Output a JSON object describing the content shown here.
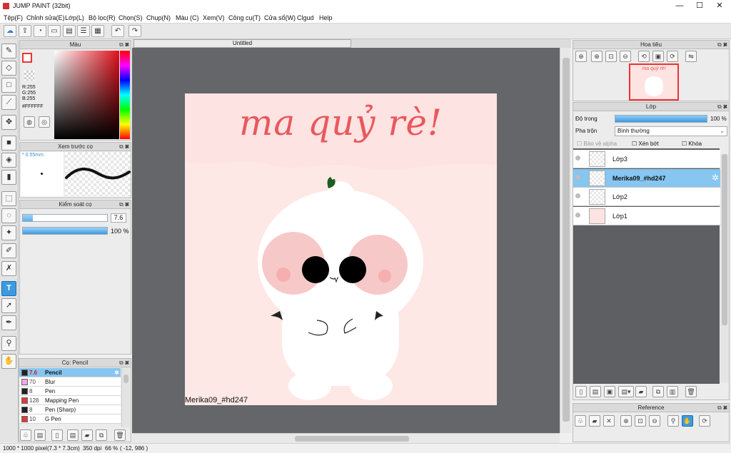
{
  "window": {
    "title": "JUMP PAINT (32bit)",
    "minimize": "—",
    "maximize": "☐",
    "close": "✕"
  },
  "menu": [
    "Tệp(F)",
    "Chỉnh sửa(E)",
    "Lớp(L)",
    "Bộ lọc(R)",
    "Chọn(S)",
    "Chụp(N)",
    "Màu (C)",
    "Xem(V)",
    "Công cụ(T)",
    "Cửa sổ(W)",
    "Clgud",
    "Help"
  ],
  "toolbar_icons": [
    "cloud-icon",
    "export-icon",
    "speech-icon",
    "screen-icon",
    "page-icon",
    "list-icon",
    "grid-icon",
    "undo-icon",
    "redo-icon"
  ],
  "color_panel": {
    "title": "Màu",
    "r": "R:255",
    "g": "G:255",
    "b": "B:255",
    "hex": "#FFFFFF"
  },
  "brush_preview": {
    "title": "Xem trước cọ",
    "size": "* 0.55mm"
  },
  "brush_control": {
    "title": "Kiểm soát cọ",
    "size_value": "7.6",
    "size_fill": 0.12,
    "opacity_value": "100 %",
    "opacity_fill": 1.0
  },
  "brush_list": {
    "title": "Cọ: Pencil",
    "items": [
      {
        "size": "7.6",
        "name": "Pencil",
        "color": "#222222",
        "selected": true
      },
      {
        "size": "70",
        "name": "Blur",
        "color": "#f3a6e6",
        "selected": false
      },
      {
        "size": "8",
        "name": "Pen",
        "color": "#222222",
        "selected": false
      },
      {
        "size": "128",
        "name": "Mapping Pen",
        "color": "#e03a3a",
        "selected": false
      },
      {
        "size": "8",
        "name": "Pen (Sharp)",
        "color": "#222222",
        "selected": false
      },
      {
        "size": "10",
        "name": "G Pen",
        "color": "#e03a3a",
        "selected": false
      }
    ]
  },
  "canvas": {
    "tab": "Untitled",
    "heading": "ma quỷ rè!",
    "signature": "Merika09_#hd247"
  },
  "navigator": {
    "title": "Hoa tiêu"
  },
  "layer_panel": {
    "title": "Lớp",
    "opacity_label": "Độ trong",
    "opacity_value": "100 %",
    "opacity_fill": 1.0,
    "blend_label": "Pha trộn",
    "blend_value": "Bình thường",
    "protect_alpha": "Bảo vệ alpha",
    "clip": "Xén bớt",
    "lock": "Khóa",
    "layers": [
      {
        "name": "Lớp3",
        "selected": false
      },
      {
        "name": "Merika09_#hd247",
        "selected": true
      },
      {
        "name": "Lớp2",
        "selected": false
      },
      {
        "name": "Lớp1",
        "selected": false
      }
    ]
  },
  "reference": {
    "title": "Reference"
  },
  "status": {
    "size": "1000 * 1000 pixel",
    "cm": "(7.3 * 7.3cm)",
    "dpi": "350 dpi",
    "zoom": "66 %",
    "coords": "( -12, 986 )"
  },
  "colors": {
    "accent": "#3d9ae0",
    "canvas_bg": "#646669",
    "doc_bg": "#fde3e1",
    "heading": "#e8585e"
  }
}
